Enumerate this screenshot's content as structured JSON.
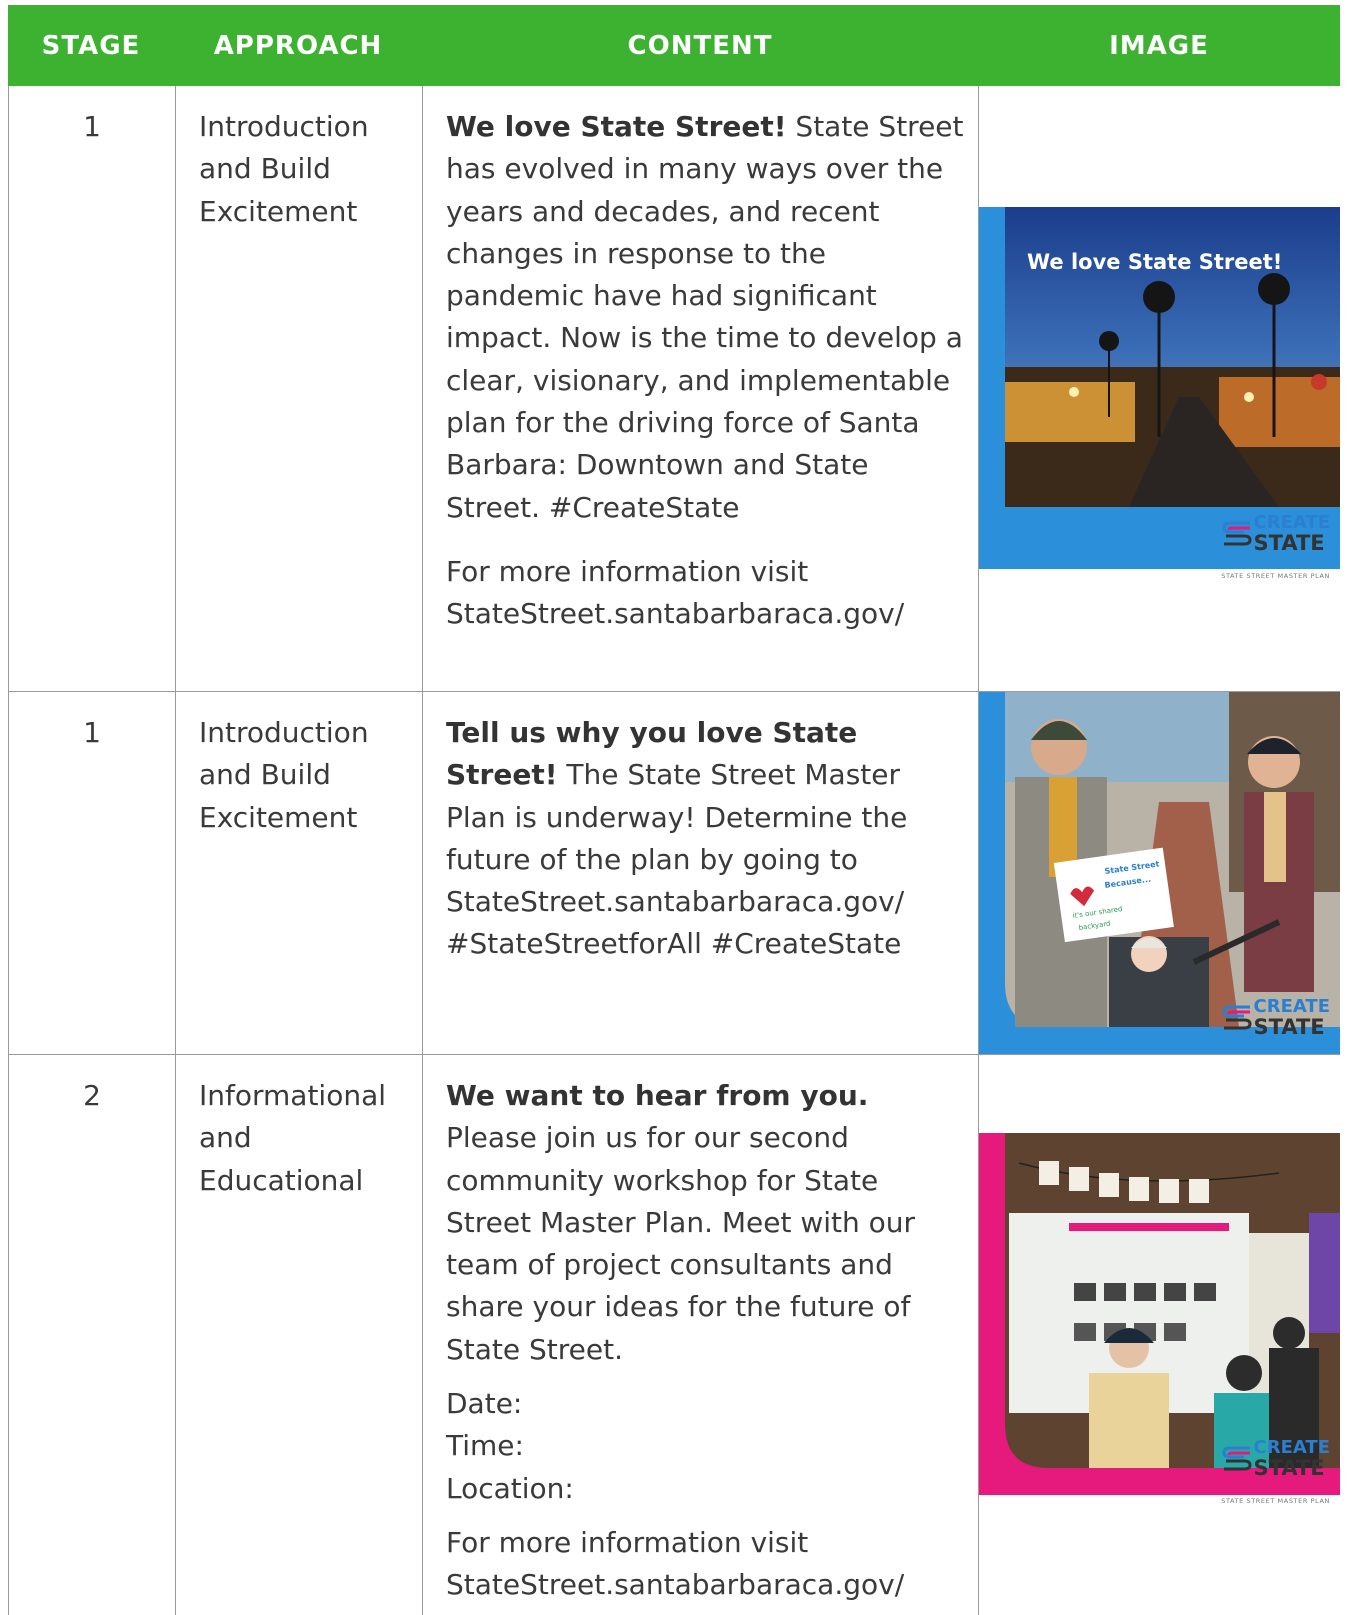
{
  "header": {
    "stage": "STAGE",
    "approach": "APPROACH",
    "content": "CONTENT",
    "image": "IMAGE"
  },
  "colors": {
    "header_bg": "#3db230",
    "row1_image_bg": "#2b90d9",
    "row2_image_bg": "#2b90d9",
    "row3_image_bg": "#e6197d"
  },
  "rows": [
    {
      "stage": "1",
      "approach": "Introduction and Build Excitement",
      "content_bold": "We love State Street!",
      "content_text": " State Street has evolved in many ways over the years and decades, and recent changes in response to the pandemic have had significant impact. Now is the time to develop a clear, visionary, and implementable plan for the driving force of Santa Barbara: Downtown and State Street. #CreateState",
      "more_info": "For more information visit StateStreet.santabarbaraca.gov/",
      "image_caption": "We love State Street!",
      "image_icon": "state-street-night-photo"
    },
    {
      "stage": "1",
      "approach": "Introduction and Build Excitement",
      "content_bold": "Tell us why you love State Street!",
      "content_text": " The State Street Master Plan is underway! Determine the future of the plan by going to StateStreet.santabarbaraca.gov/ #StateStreetforAll #CreateState",
      "image_icon": "family-holding-sign-photo",
      "sign_line1": "State Street",
      "sign_line2": "Because...",
      "sign_line3": "it's our shared",
      "sign_line4": "backyard"
    },
    {
      "stage": "2",
      "approach": "Informational and Educational",
      "content_bold": "We want to hear from you.",
      "content_text": " Please join us for our second community workshop for State Street Master Plan. Meet with our team of project consultants and share your ideas for the future of State Street.",
      "date_label": "Date:",
      "time_label": "Time:",
      "location_label": "Location:",
      "more_info": "For more information visit StateStreet.santabarbaraca.gov/",
      "image_icon": "workshop-boards-photo"
    }
  ],
  "logo": {
    "line1": "CREATE",
    "line2": "STATE",
    "sub": "STATE STREET MASTER PLAN"
  }
}
